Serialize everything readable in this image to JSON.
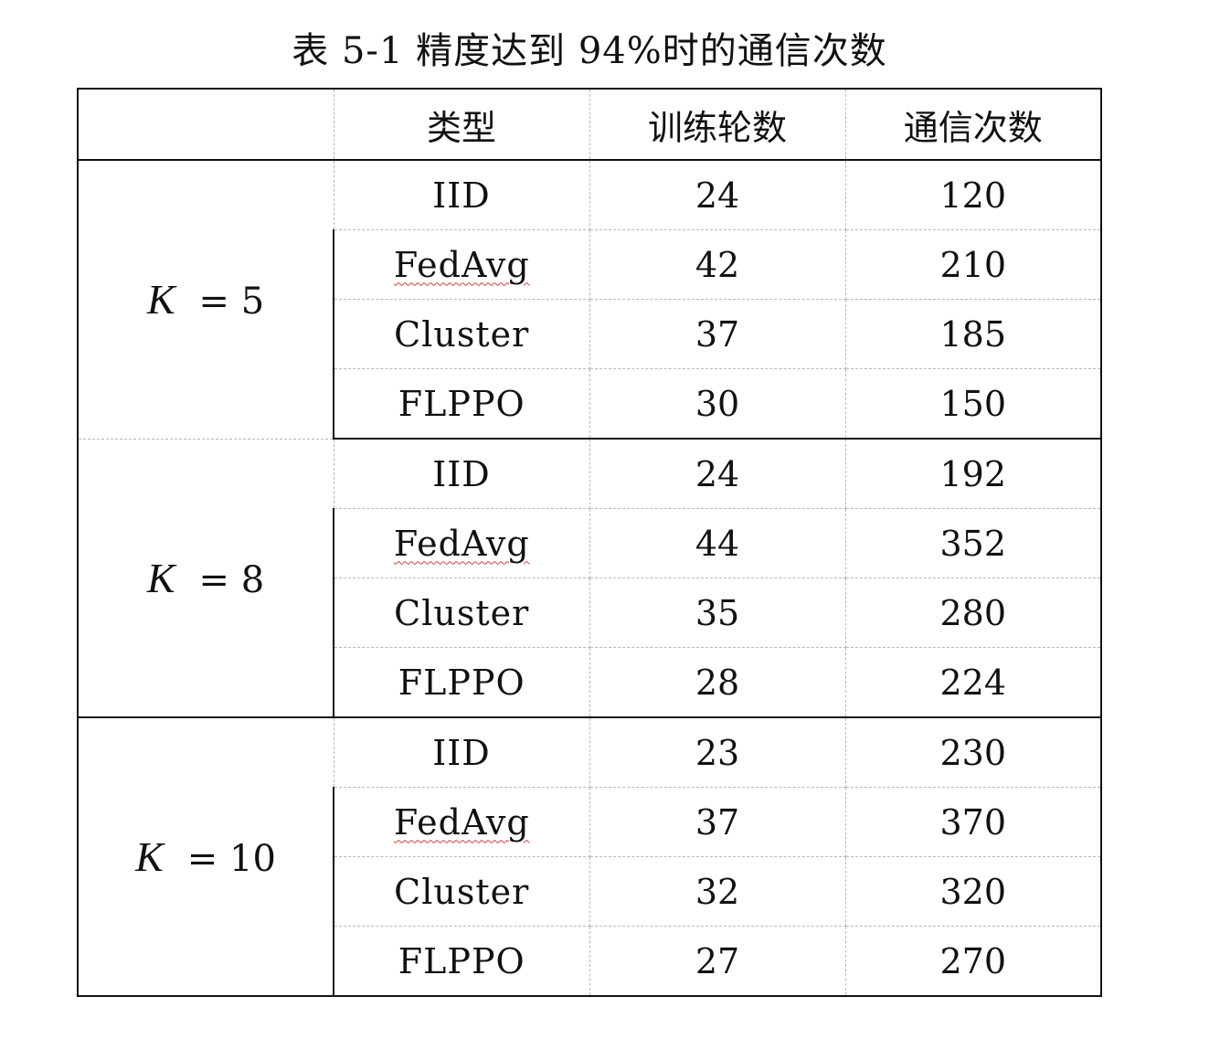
{
  "caption": "表 5-1 精度达到 94%时的通信次数",
  "headers": [
    "",
    "类型",
    "训练轮数",
    "通信次数"
  ],
  "groups": [
    {
      "var": "K",
      "eq": "= 5",
      "rows": [
        {
          "type": "IID",
          "rounds": "24",
          "comms": "120"
        },
        {
          "type": "FedAvg",
          "rounds": "42",
          "comms": "210"
        },
        {
          "type": "Cluster",
          "rounds": "37",
          "comms": "185"
        },
        {
          "type": "FLPPO",
          "rounds": "30",
          "comms": "150"
        }
      ]
    },
    {
      "var": "K",
      "eq": "= 8",
      "rows": [
        {
          "type": "IID",
          "rounds": "24",
          "comms": "192"
        },
        {
          "type": "FedAvg",
          "rounds": "44",
          "comms": "352"
        },
        {
          "type": "Cluster",
          "rounds": "35",
          "comms": "280"
        },
        {
          "type": "FLPPO",
          "rounds": "28",
          "comms": "224"
        }
      ]
    },
    {
      "var": "K",
      "eq": "= 10",
      "rows": [
        {
          "type": "IID",
          "rounds": "23",
          "comms": "230"
        },
        {
          "type": "FedAvg",
          "rounds": "37",
          "comms": "370"
        },
        {
          "type": "Cluster",
          "rounds": "32",
          "comms": "320"
        },
        {
          "type": "FLPPO",
          "rounds": "27",
          "comms": "270"
        }
      ]
    }
  ]
}
